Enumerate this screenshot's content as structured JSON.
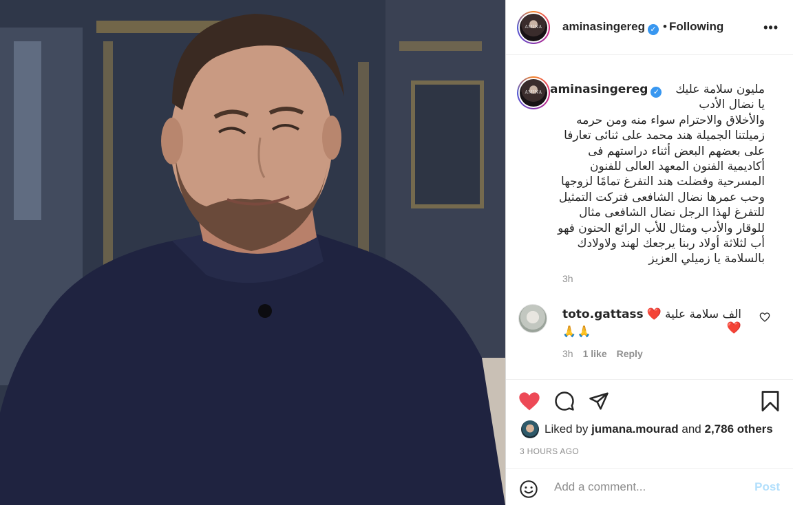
{
  "post": {
    "photo_alt": "",
    "author": {
      "username": "aminasingereg",
      "avatar_text": "AMINA",
      "verified": true
    },
    "follow_status": "Following",
    "more_icon": "more-horizontal-icon",
    "caption": {
      "username": "aminasingereg",
      "text": "مليون سلامة عليك يا نضال الأدب والأخلاق والاحترام سواء منه ومن حرمه زميلتنا الجميلة هند محمد على ثنائى تعارفا على بعضهم البعض أثناء دراستهم فى أكاديمية الفنون المعهد العالى للفنون المسرحية وفضلت هند التفرغ تمامًا لزوجها وحب عمرها نضال الشافعى فتركت التمثيل للتفرغ لهذا الرجل نضال الشافعى مثال للوقار والأدب ومثال للأب الرائع الحنون فهو أب لثلاثة أولاد ربنا يرجعك لهند ولاولادك بالسلامة يا زميلي العزيز",
      "time": "3h"
    },
    "comments": [
      {
        "username": "toto.gattass",
        "text": "الف سلامة علية ❤️❤️",
        "emoji_line": "🙏🙏",
        "time": "3h",
        "likes": "1 like",
        "reply_label": "Reply"
      }
    ],
    "likes": {
      "prefix": "Liked by",
      "user": "jumana.mourad",
      "and": "and",
      "others": "2,786 others"
    },
    "posted_ago": "3 HOURS AGO",
    "add_comment": {
      "placeholder": "Add a comment...",
      "post_label": "Post"
    }
  },
  "colors": {
    "like_red": "#ed4956",
    "verified_blue": "#3897f0",
    "post_disabled": "#b2dffc",
    "muted": "#8e8e8e"
  }
}
